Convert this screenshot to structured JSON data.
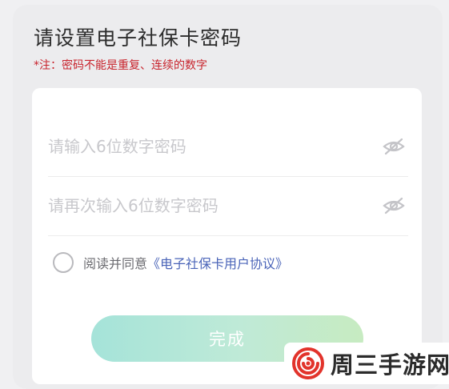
{
  "header": {
    "title": "请设置电子社保卡密码",
    "note": "*注：密码不能是重复、连续的数字"
  },
  "form": {
    "password_placeholder": "请输入6位数字密码",
    "confirm_placeholder": "请再次输入6位数字密码",
    "agreement_prefix": "阅读并同意",
    "agreement_link": "《电子社保卡用户协议》",
    "agreement_checked": false,
    "submit_label": "完成"
  },
  "watermark": {
    "text": "周三手游网"
  },
  "colors": {
    "note_red": "#c8232c",
    "link_blue": "#4a64b8",
    "button_gradient_start": "#a5e3d9",
    "button_gradient_end": "#c7ebc1",
    "logo_red": "#e2332b"
  },
  "icons": {
    "password_toggle": "eye-off-icon",
    "confirm_toggle": "eye-off-icon",
    "agreement_checkbox": "radio-circle-icon",
    "watermark_logo": "spiral-logo"
  }
}
